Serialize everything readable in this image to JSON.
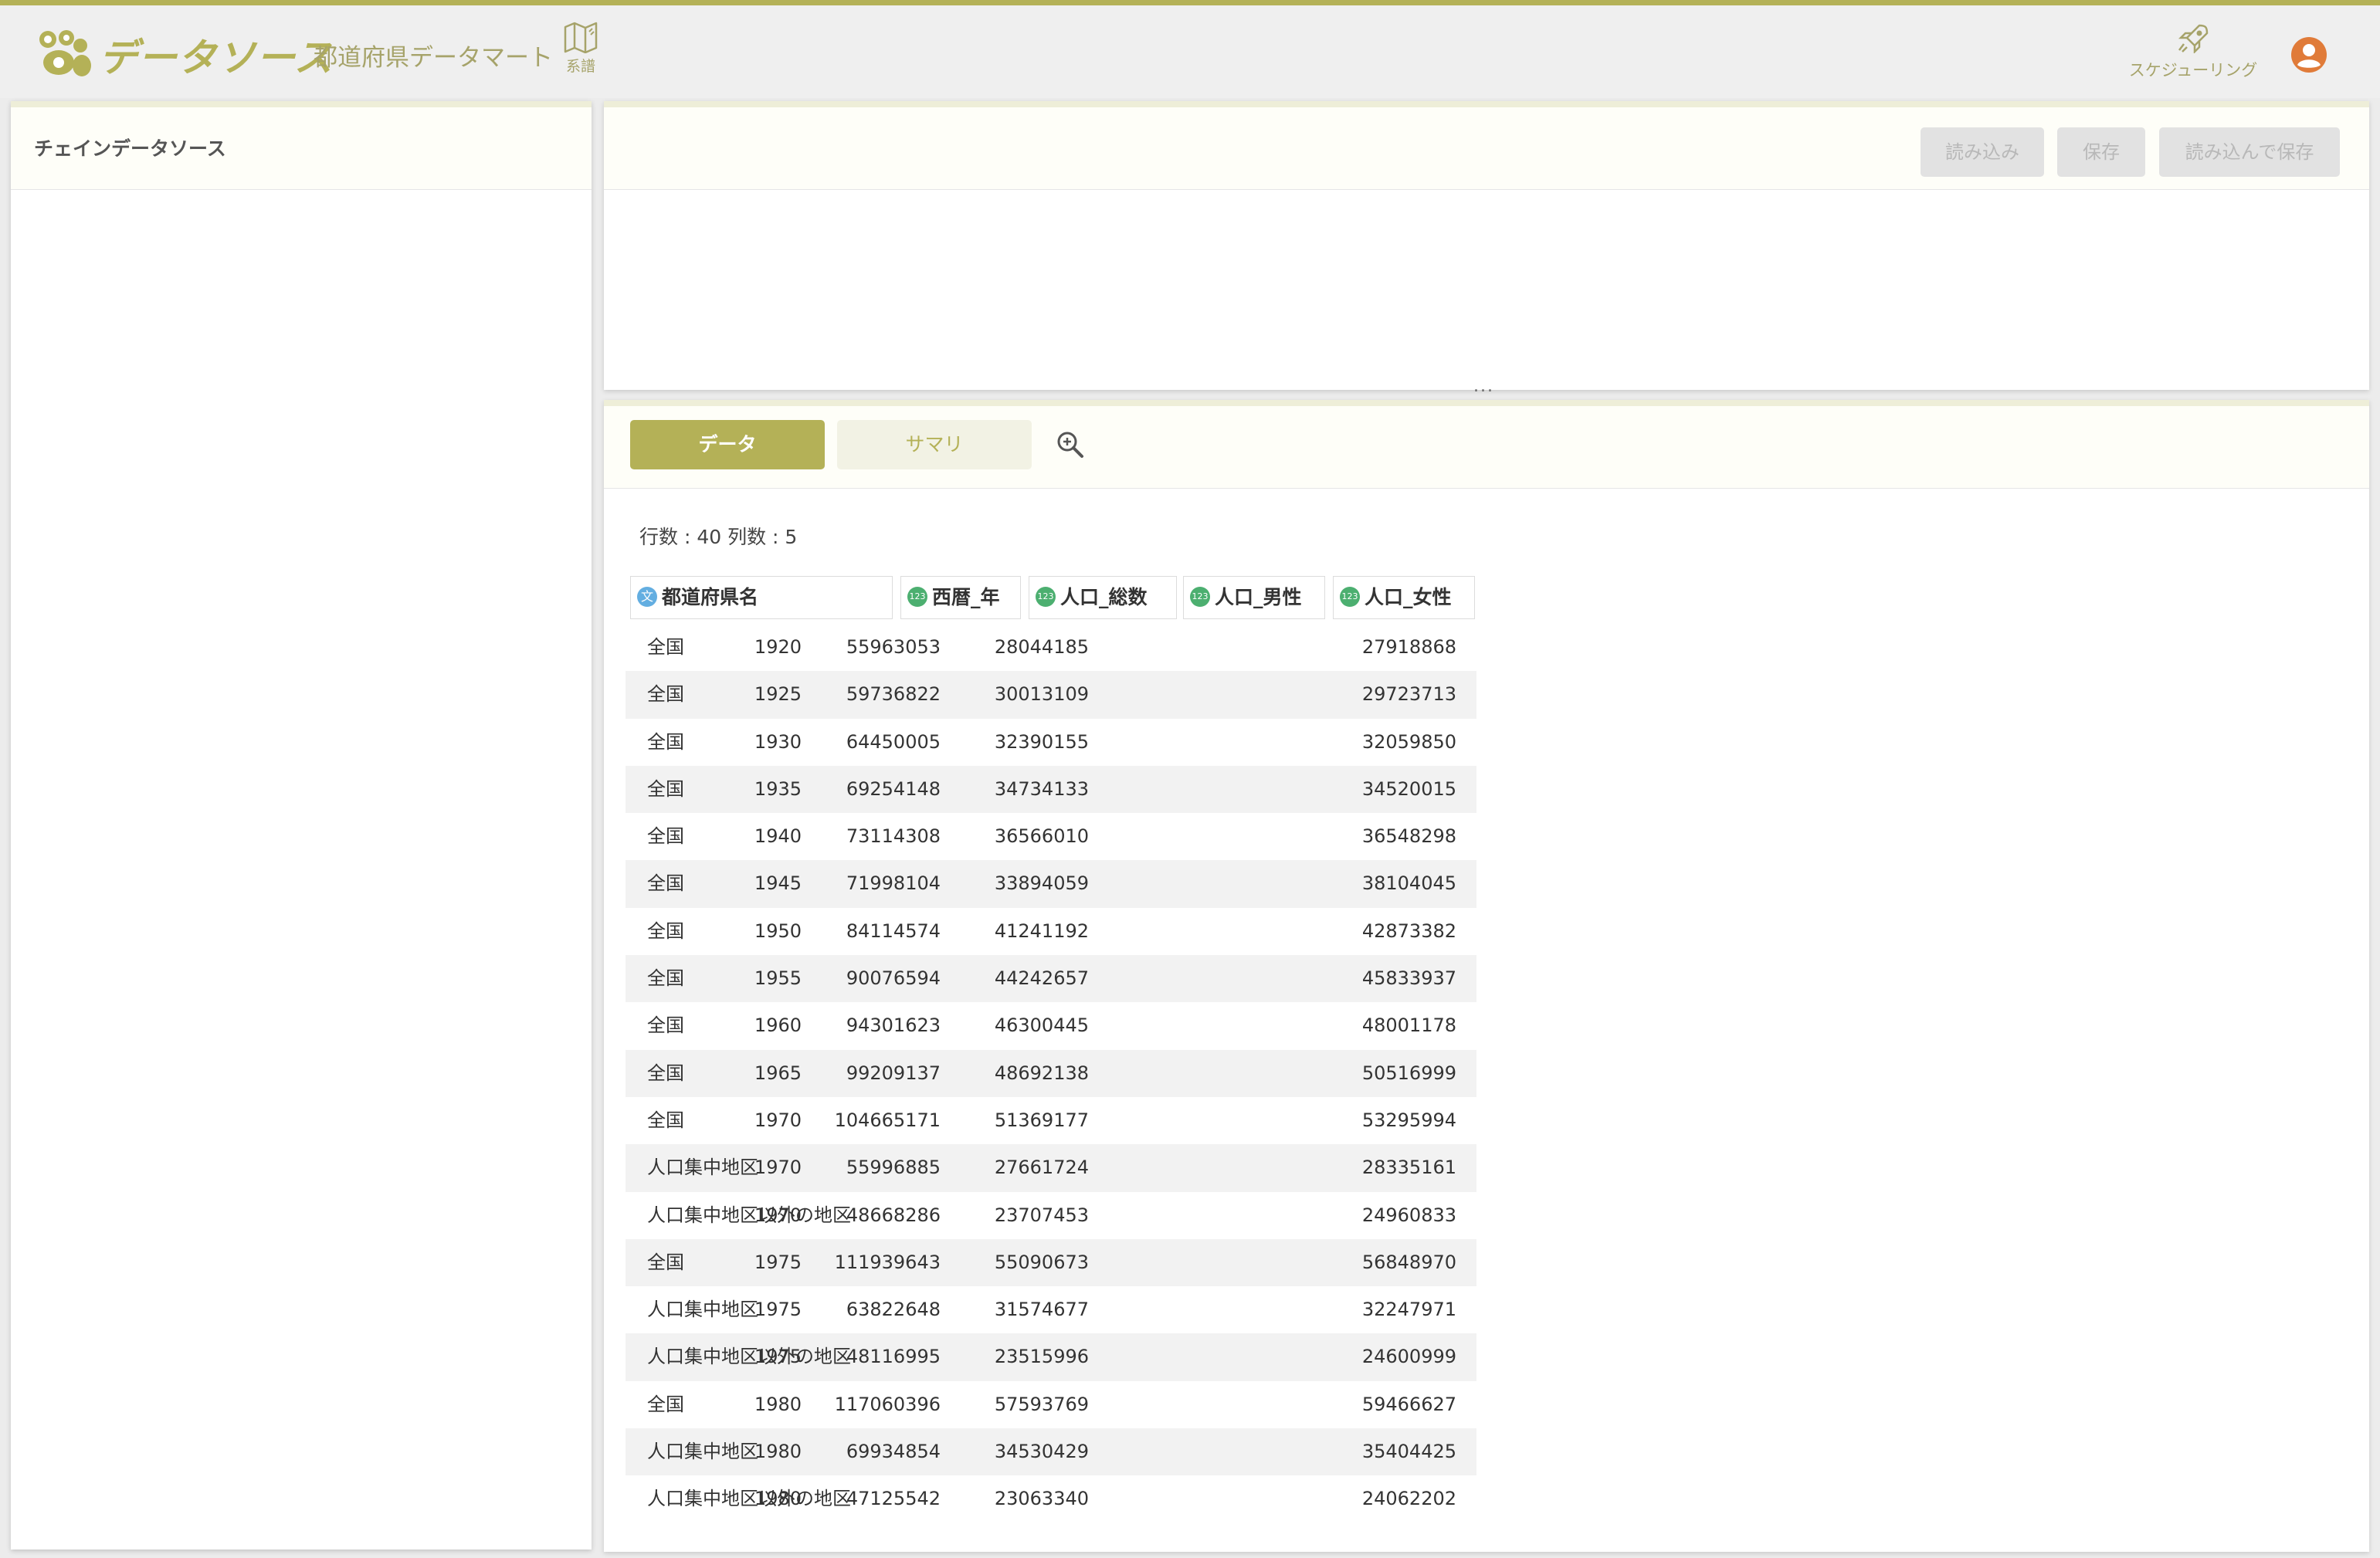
{
  "header": {
    "app_title": "データソース",
    "mart_name": "都道府県データマート",
    "lineage_label": "系譜",
    "scheduling_label": "スケジューリング"
  },
  "left_panel": {
    "title": "チェインデータソース"
  },
  "toolbar": {
    "load_label": "読み込み",
    "save_label": "保存",
    "load_save_label": "読み込んで保存"
  },
  "splitter": "...",
  "tabs": {
    "data_label": "データ",
    "summary_label": "サマリ"
  },
  "counts": "行数 : 40 列数 : 5",
  "columns": [
    {
      "label": "都道府県名",
      "type_badge": "文"
    },
    {
      "label": "西暦_年",
      "type_badge": "123"
    },
    {
      "label": "人口_総数",
      "type_badge": "123"
    },
    {
      "label": "人口_男性",
      "type_badge": "123"
    },
    {
      "label": "人口_女性",
      "type_badge": "123"
    }
  ],
  "rows": [
    [
      "全国",
      "1920",
      "55963053",
      "28044185",
      "27918868"
    ],
    [
      "全国",
      "1925",
      "59736822",
      "30013109",
      "29723713"
    ],
    [
      "全国",
      "1930",
      "64450005",
      "32390155",
      "32059850"
    ],
    [
      "全国",
      "1935",
      "69254148",
      "34734133",
      "34520015"
    ],
    [
      "全国",
      "1940",
      "73114308",
      "36566010",
      "36548298"
    ],
    [
      "全国",
      "1945",
      "71998104",
      "33894059",
      "38104045"
    ],
    [
      "全国",
      "1950",
      "84114574",
      "41241192",
      "42873382"
    ],
    [
      "全国",
      "1955",
      "90076594",
      "44242657",
      "45833937"
    ],
    [
      "全国",
      "1960",
      "94301623",
      "46300445",
      "48001178"
    ],
    [
      "全国",
      "1965",
      "99209137",
      "48692138",
      "50516999"
    ],
    [
      "全国",
      "1970",
      "104665171",
      "51369177",
      "53295994"
    ],
    [
      "人口集中地区",
      "1970",
      "55996885",
      "27661724",
      "28335161"
    ],
    [
      "人口集中地区以外の地区",
      "1970",
      "48668286",
      "23707453",
      "24960833"
    ],
    [
      "全国",
      "1975",
      "111939643",
      "55090673",
      "56848970"
    ],
    [
      "人口集中地区",
      "1975",
      "63822648",
      "31574677",
      "32247971"
    ],
    [
      "人口集中地区以外の地区",
      "1975",
      "48116995",
      "23515996",
      "24600999"
    ],
    [
      "全国",
      "1980",
      "117060396",
      "57593769",
      "59466627"
    ],
    [
      "人口集中地区",
      "1980",
      "69934854",
      "34530429",
      "35404425"
    ],
    [
      "人口集中地区以外の地区",
      "1980",
      "47125542",
      "23063340",
      "24062202"
    ]
  ],
  "colors": {
    "accent": "#b4b157",
    "accent_light": "#eeeed8",
    "text_badge": "#63aee1",
    "number_badge": "#4caf70",
    "avatar": "#e07b39"
  },
  "icons": [
    "logo-icon",
    "map-book-icon",
    "rocket-icon",
    "user-avatar-icon",
    "zoom-in-icon"
  ]
}
